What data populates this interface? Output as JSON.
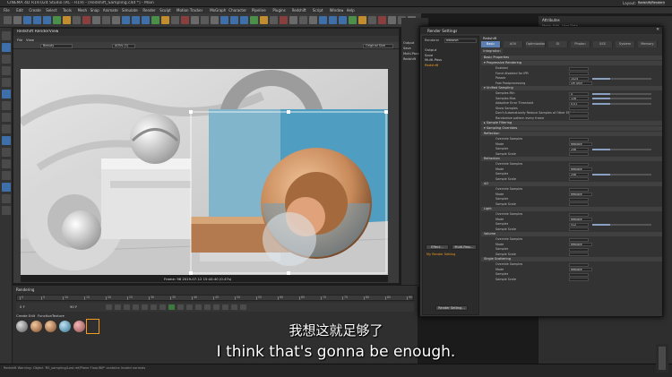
{
  "app": {
    "title": "CINEMA 4D R19.024 Studio (RC - R19) - [Redshift_Sampling.c4d *] - Main",
    "menu": [
      "File",
      "Edit",
      "Create",
      "Select",
      "Tools",
      "Mesh",
      "Snap",
      "Animate",
      "Simulate",
      "Render",
      "Sculpt",
      "Motion Tracker",
      "MoGraph",
      "Character",
      "Pipeline",
      "Plugins",
      "Redshift",
      "Script",
      "Window",
      "Help"
    ],
    "layout_label": "Layout:",
    "layout_value": "Redshift/Rendering (User)"
  },
  "view": {
    "window_title": "Redshift RenderView",
    "menu": [
      "File",
      "View"
    ],
    "beauty": "Beauty",
    "aovs": "AOVs (1)",
    "original_size": "Original Size",
    "frame_text": "Frame: 98  2019-07-12  15:44:40  (0.47s)"
  },
  "timeline": {
    "rendering_label": "Rendering",
    "ticks": [
      "0",
      "5",
      "10",
      "15",
      "20",
      "25",
      "30",
      "35",
      "40",
      "45",
      "50",
      "55",
      "60",
      "65",
      "70",
      "75",
      "80",
      "85",
      "90"
    ],
    "frame_start": "0 F",
    "frame_end": "90 F",
    "mat_menu": [
      "Create",
      "Edit",
      "Function",
      "Texture"
    ]
  },
  "statusbar": {
    "text": "Redshift Warning: Object 'RS_sampling/Lost ref/Plane Floor/BiP' contains invalid normals"
  },
  "objects_panel": {
    "items": [
      "Output",
      "Save",
      "Multi-Pass",
      "Redshift"
    ]
  },
  "attributes": {
    "title": "Attributes",
    "menu": [
      "Mode",
      "Edit",
      "User Data"
    ],
    "node": "Redshift"
  },
  "render_settings": {
    "title": "Render Settings",
    "renderer_label": "Renderer",
    "renderer_value": "Redshift",
    "left_items": [
      {
        "label": "Output",
        "active": false
      },
      {
        "label": "Save",
        "active": false
      },
      {
        "label": "Multi-Pass",
        "active": false
      },
      {
        "label": "Redshift",
        "active": true
      }
    ],
    "effect_button": "Effect...",
    "multipass_button": "Multi-Pass...",
    "my_setting": "My Render Setting",
    "render_setting_button": "Render Setting...",
    "section_title": "Redshift",
    "tabs": [
      "Basic",
      "AOV",
      "Optimization",
      "GI",
      "Photon",
      "SSS",
      "System",
      "Memory"
    ],
    "integration_tab": "Integration",
    "sections": [
      {
        "title": "Basic Properties",
        "rows": []
      },
      {
        "title": "▾ Progressive Rendering",
        "rows": [
          {
            "k": "Enabled",
            "v": ""
          },
          {
            "k": "Force disabled for IPR",
            "v": ""
          },
          {
            "k": "Passes",
            "v": "1024"
          },
          {
            "k": "Fast Postprocessing",
            "v": "Off Only"
          }
        ]
      },
      {
        "title": "▾ Unified Sampling",
        "rows": [
          {
            "k": "Samples Min",
            "v": "4"
          },
          {
            "k": "Samples Max",
            "v": "128"
          },
          {
            "k": "Adaptive Error Threshold",
            "v": "0.01"
          },
          {
            "k": "Show Samples",
            "v": ""
          },
          {
            "k": "Don't Automatically Reduce Samples of Other Effects",
            "v": ""
          },
          {
            "k": "Randomize pattern every frame",
            "v": ""
          }
        ]
      },
      {
        "title": "▸ Sample Filtering",
        "rows": []
      },
      {
        "title": "▾ Sampling Overrides",
        "rows": []
      },
      {
        "title": "Reflection",
        "rows": [
          {
            "k": "Override Samples",
            "v": ""
          },
          {
            "k": "Mode",
            "v": "Replace"
          },
          {
            "k": "Samples",
            "v": "256"
          },
          {
            "k": "Sample Scale",
            "v": ""
          }
        ]
      },
      {
        "title": "Refraction",
        "rows": [
          {
            "k": "Override Samples",
            "v": ""
          },
          {
            "k": "Mode",
            "v": "Replace"
          },
          {
            "k": "Samples",
            "v": "256"
          },
          {
            "k": "Sample Scale",
            "v": ""
          }
        ]
      },
      {
        "title": "AO",
        "rows": [
          {
            "k": "Override Samples",
            "v": ""
          },
          {
            "k": "Mode",
            "v": "Replace"
          },
          {
            "k": "Samples",
            "v": ""
          },
          {
            "k": "Sample Scale",
            "v": ""
          }
        ]
      },
      {
        "title": "Light",
        "rows": [
          {
            "k": "Override Samples",
            "v": ""
          },
          {
            "k": "Mode",
            "v": "Replace"
          },
          {
            "k": "Samples",
            "v": "512"
          },
          {
            "k": "Sample Scale",
            "v": ""
          }
        ]
      },
      {
        "title": "Volume",
        "rows": [
          {
            "k": "Override Samples",
            "v": ""
          },
          {
            "k": "Mode",
            "v": "Replace"
          },
          {
            "k": "Samples",
            "v": ""
          },
          {
            "k": "Sample Scale",
            "v": ""
          }
        ]
      },
      {
        "title": "Single Scattering",
        "rows": [
          {
            "k": "Override Samples",
            "v": ""
          },
          {
            "k": "Mode",
            "v": "Replace"
          },
          {
            "k": "Samples",
            "v": ""
          },
          {
            "k": "Sample Scale",
            "v": ""
          }
        ]
      }
    ]
  },
  "subtitles": {
    "zh": "我想这就足够了",
    "en": "I think that's gonna be enough."
  },
  "colors": {
    "accent_active": "#f29c1f",
    "tab_active": "#5b7fb0",
    "scene_blue": "#4f9ec2",
    "scene_copper": "#c88a5a"
  }
}
